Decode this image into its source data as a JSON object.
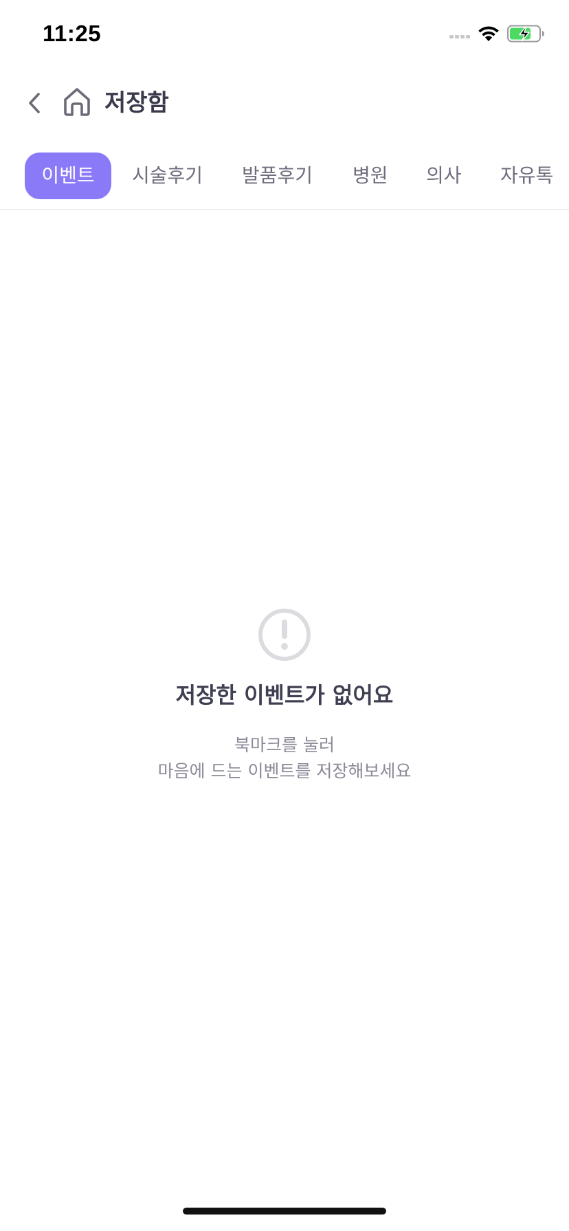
{
  "status_bar": {
    "time": "11:25",
    "icons": [
      "cellular-signal-icon",
      "wifi-icon",
      "battery-charging-icon"
    ],
    "battery_color": "#4cd964"
  },
  "header": {
    "back_icon": "chevron-left-icon",
    "home_icon": "home-icon",
    "title": "저장함"
  },
  "tabs": {
    "active_index": 0,
    "accent_color": "#8a7af8",
    "items": [
      {
        "label": "이벤트"
      },
      {
        "label": "시술후기"
      },
      {
        "label": "발품후기"
      },
      {
        "label": "병원"
      },
      {
        "label": "의사"
      },
      {
        "label": "자유톡"
      }
    ]
  },
  "empty_state": {
    "icon": "exclamation-circle-icon",
    "title": "저장한 이벤트가 없어요",
    "desc_line1": "북마크를 눌러",
    "desc_line2": "마음에 드는 이벤트를 저장해보세요"
  }
}
